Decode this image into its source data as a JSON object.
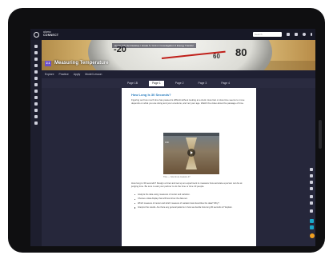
{
  "app": {
    "brand_top": "alamo",
    "brand_name": "CONNECT",
    "search_placeholder": "Search"
  },
  "banner": {
    "breadcrumb": "Home / My Sci Desktop / Grade 5 / Unit 2 / Investigation 3 Energy Transfer",
    "gauge_numbers": [
      "-20",
      "80",
      "60"
    ],
    "badge": "2.1",
    "title": "Measuring Temperature"
  },
  "subnav": {
    "items": [
      "Explore",
      "Practice",
      "Apply",
      "Model Lesson"
    ]
  },
  "tabs": {
    "items": [
      "Page 1B",
      "Page 1",
      "Page 2",
      "Page 3",
      "Page 4"
    ],
    "active_index": 1
  },
  "doc": {
    "heading": "How Long Is 30 Seconds?",
    "para1": "Figuring out how much time has passed is difficult without looking at a clock. How fast or slow time seems to move depends on what you are doing and your emotions, and not your age. Watch the video about the passage of time.",
    "video_time": "0:00",
    "caption": "Time — how do we measure it?",
    "para2": "How long is 30 seconds? Design a timer and set up an experiment to measure how accurate a person can be at judging time. Be sure to ask your partner to do the time or time 10 people.",
    "bullets": [
      "Analyze the data using measures of center and variation.",
      "Choose a data display that will best show the data set.",
      "Which measure of center and which measure of variation best describes the data? Why?",
      "Interpret the results. Are there any general patterns in how we decide how long 30 seconds is? Explain."
    ]
  },
  "colors": {
    "topbar": "#171826",
    "accent": "#6b4fc9",
    "heading": "#2c7fbf",
    "teal": "#19a7c9",
    "orange": "#f0a020"
  }
}
